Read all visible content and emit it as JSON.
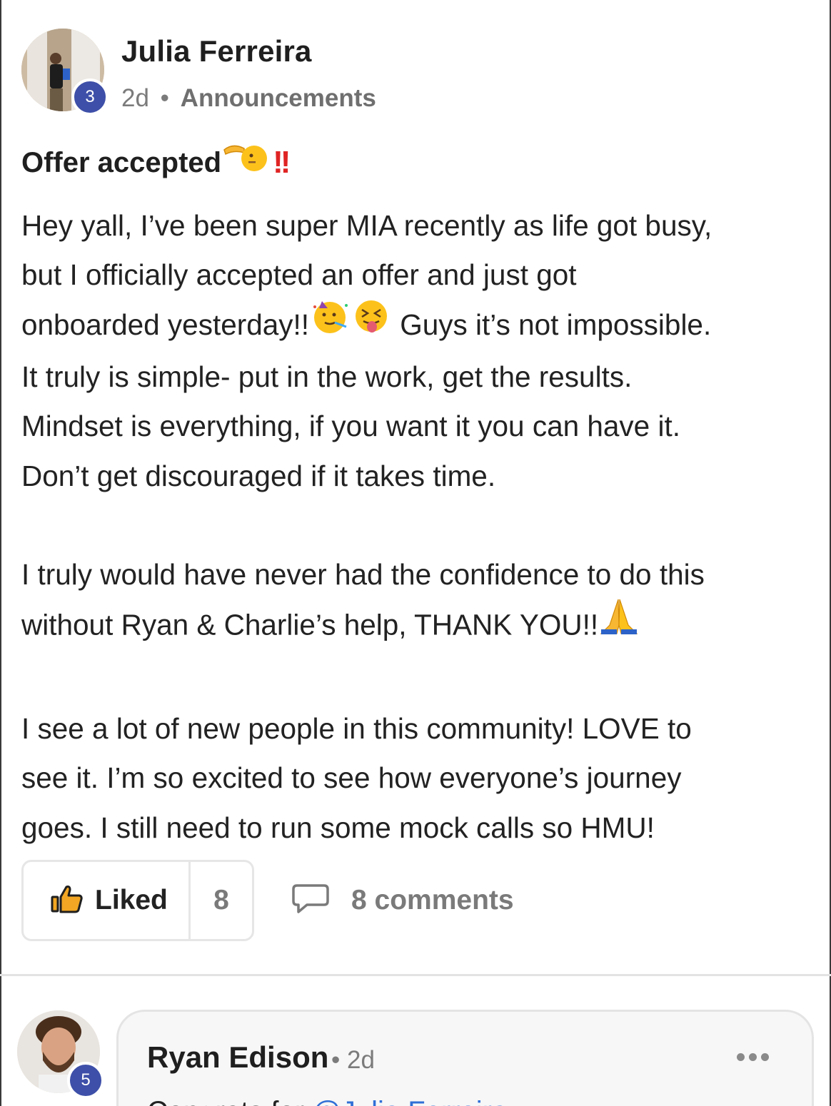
{
  "post": {
    "author": {
      "name": "Julia Ferreira",
      "level": "3"
    },
    "time": "2d",
    "separator": "•",
    "category": "Announcements",
    "title": "Offer accepted",
    "title_emojis": [
      "backhand-index-pointing-left-emoji",
      "double-exclamation-emoji"
    ],
    "body": {
      "line1": "Hey yall, I’ve been super MIA recently as life got busy,",
      "line2": "but I officially accepted an offer and just got",
      "line3a": "onboarded yesterday!!",
      "line3b": " Guys it’s not impossible.",
      "line4": "It truly is simple- put in the work, get the results.",
      "line5": "Mindset is everything, if you want it you can have it.",
      "line6": "Don’t get discouraged if it takes time.",
      "line7": "I truly would have never had the confidence to do this",
      "line8": "without Ryan & Charlie’s help, THANK YOU!!",
      "line9": "I see a lot of new people in this community! LOVE to",
      "line10": "see it. I’m so excited to see how everyone’s journey",
      "line11": "goes. I still need to run some mock calls so HMU!"
    },
    "actions": {
      "like_label": "Liked",
      "like_count": "8",
      "comments_label": "8 comments"
    }
  },
  "comment": {
    "author": {
      "name": "Ryan Edison",
      "level": "5"
    },
    "separator": "•",
    "time": "2d",
    "snippet_start": "Congrats for ",
    "mention": "@Julia Ferreira"
  },
  "colors": {
    "level_badge": "#3d4fa8",
    "mention": "#2f6fd6",
    "exclamation": "#e02424"
  },
  "icons": [
    "thumbs-up-icon",
    "comment-bubble-icon",
    "more-options-icon"
  ]
}
